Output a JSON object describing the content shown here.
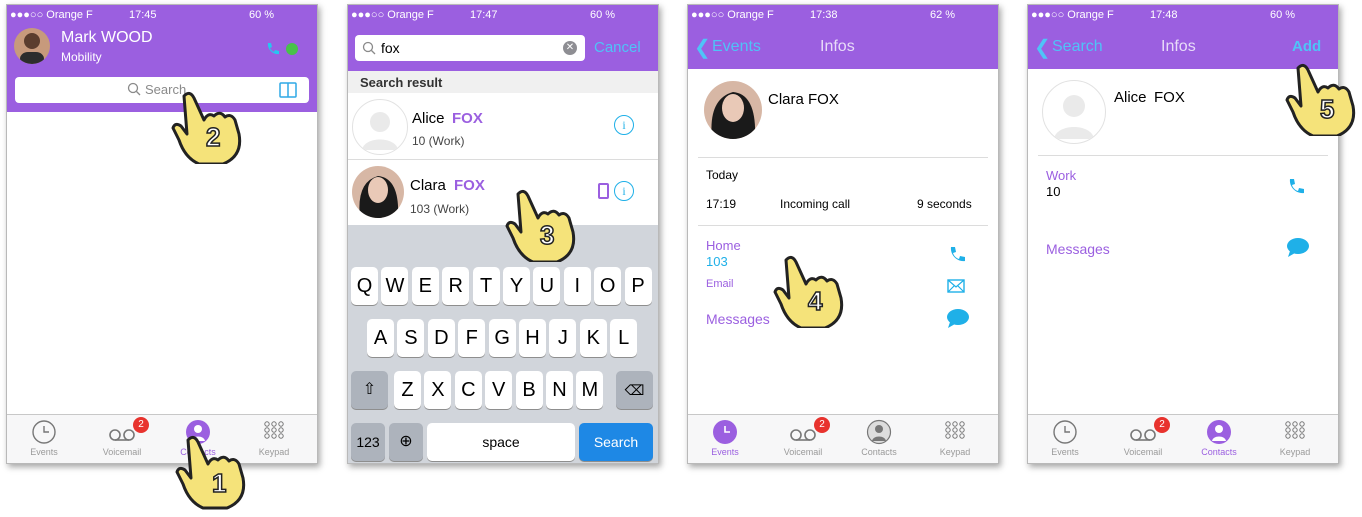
{
  "colors": {
    "accent": "#9b5fe0",
    "cyan": "#1fb0e8",
    "badge": "#e8332e"
  },
  "screens": [
    {
      "status": {
        "carrier": "●●●○○ Orange F",
        "time": "17:45",
        "battery": "60 %"
      },
      "header": {
        "name": "Mark WOOD",
        "subtitle": "Mobility"
      },
      "search": {
        "placeholder": "Search"
      },
      "step": "2"
    },
    {
      "status": {
        "carrier": "●●●○○ Orange F",
        "time": "17:47",
        "battery": "60 %"
      },
      "search": {
        "value": "fox",
        "cancel": "Cancel"
      },
      "results_header": "Search result",
      "results": [
        {
          "first": "Alice",
          "last": "FOX",
          "detail": "10  (Work)"
        },
        {
          "first": "Clara",
          "last": "FOX",
          "detail": "103 (Work)"
        }
      ],
      "keyboard": {
        "row1": [
          "Q",
          "W",
          "E",
          "R",
          "T",
          "Y",
          "U",
          "I",
          "O",
          "P"
        ],
        "row2": [
          "A",
          "S",
          "D",
          "F",
          "G",
          "H",
          "J",
          "K",
          "L"
        ],
        "row3": [
          "Z",
          "X",
          "C",
          "V",
          "B",
          "N",
          "M"
        ],
        "numbers": "123",
        "space": "space",
        "search": "Search"
      },
      "step": "3"
    },
    {
      "status": {
        "carrier": "●●●○○ Orange F",
        "time": "17:38",
        "battery": "62 %"
      },
      "back": "Events",
      "title": "Infos",
      "contact_name": "Clara FOX",
      "section": "Today",
      "call": {
        "time": "17:19",
        "type": "Incoming call",
        "duration": "9 seconds"
      },
      "home_label": "Home",
      "home_number": "103",
      "email_label": "Email",
      "messages_label": "Messages",
      "step": "4"
    },
    {
      "status": {
        "carrier": "●●●○○ Orange F",
        "time": "17:48",
        "battery": "60 %"
      },
      "back": "Search",
      "title": "Infos",
      "add": "Add",
      "contact_first": "Alice",
      "contact_last": "FOX",
      "work_label": "Work",
      "work_number": "10",
      "messages_label": "Messages",
      "step": "5"
    }
  ],
  "nav": {
    "events": "Events",
    "voicemail": "Voicemail",
    "contacts": "Contacts",
    "keypad": "Keypad",
    "badge": "2"
  },
  "step1": "1",
  "icons": [
    "clock-icon",
    "voicemail-icon",
    "contact-icon",
    "keypad-icon",
    "search-icon",
    "book-icon",
    "phone-icon",
    "mail-icon",
    "chat-icon",
    "info-icon",
    "mobile-icon",
    "back-chevron-icon",
    "hand-pointer-icon"
  ]
}
